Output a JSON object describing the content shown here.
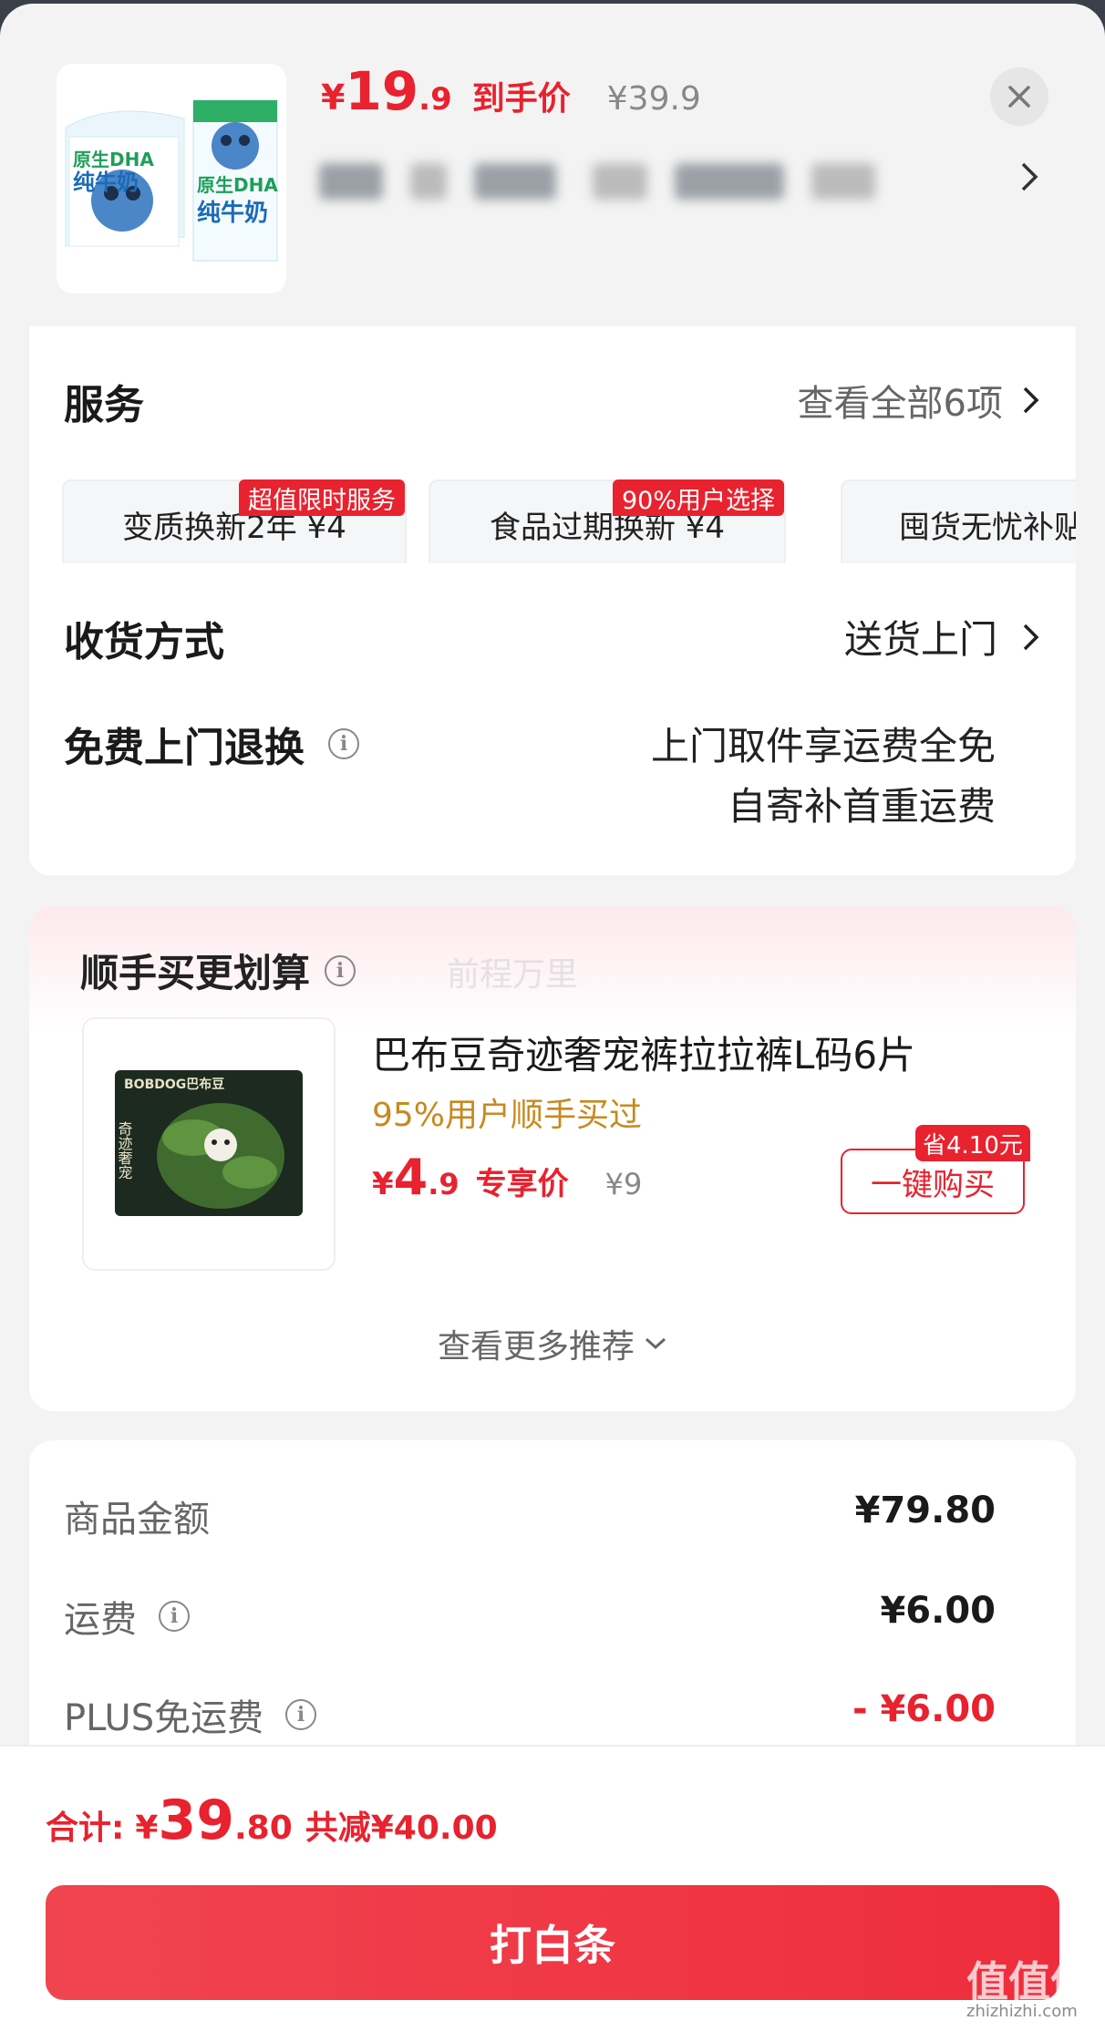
{
  "header": {
    "price_currency": "¥",
    "price_int": "19",
    "price_dec": ".9",
    "price_tag": "到手价",
    "original_price": "¥39.9",
    "close_icon": "close-icon",
    "chevron_icon": "chevron-right-icon"
  },
  "product_thumb": {
    "labels": [
      "原生DHA",
      "纯牛奶",
      "原生DHA",
      "纯牛奶"
    ]
  },
  "services": {
    "title": "服务",
    "view_all": "查看全部6项",
    "items": [
      {
        "label": "变质换新2年  ¥4",
        "badge": "超值限时服务"
      },
      {
        "label": "食品过期换新  ¥4",
        "badge": "90%用户选择"
      },
      {
        "label": "囤货无忧补贴",
        "badge": ""
      }
    ]
  },
  "delivery": {
    "title": "收货方式",
    "value": "送货上门"
  },
  "returns": {
    "title": "免费上门退换",
    "line1": "上门取件享运费全免",
    "line2": "自寄补首重运费"
  },
  "recommend": {
    "title": "顺手买更划算",
    "watermark": "前程万里",
    "product_title": "巴布豆奇迹奢宠裤拉拉裤L码6片",
    "buy_rate": "95%用户顺手买过",
    "price_currency": "¥",
    "price_int": "4",
    "price_dec": ".9",
    "price_tag": "专享价",
    "original_price": "¥9",
    "save_badge": "省4.10元",
    "buy_button": "一键购买",
    "more": "查看更多推荐",
    "thumb_brand": "BOBDOG巴布豆",
    "thumb_name": "奇迹奢宠"
  },
  "summary": {
    "rows": [
      {
        "label": "商品金额",
        "value": "¥79.80",
        "info": false
      },
      {
        "label": "运费",
        "value": "¥6.00",
        "info": true
      },
      {
        "label": "PLUS免运费",
        "value": "- ¥6.00",
        "info": true
      }
    ]
  },
  "bottom": {
    "total_label": "合计:",
    "total_currency": "¥",
    "total_int": "39",
    "total_dec": ".80",
    "discount": "共减¥40.00",
    "pay_button": "打白条",
    "watermark_main": "值值值",
    "watermark_url": "zhizhizhi.com"
  },
  "colors": {
    "accent": "#e8222e",
    "gold": "#c8891e"
  }
}
